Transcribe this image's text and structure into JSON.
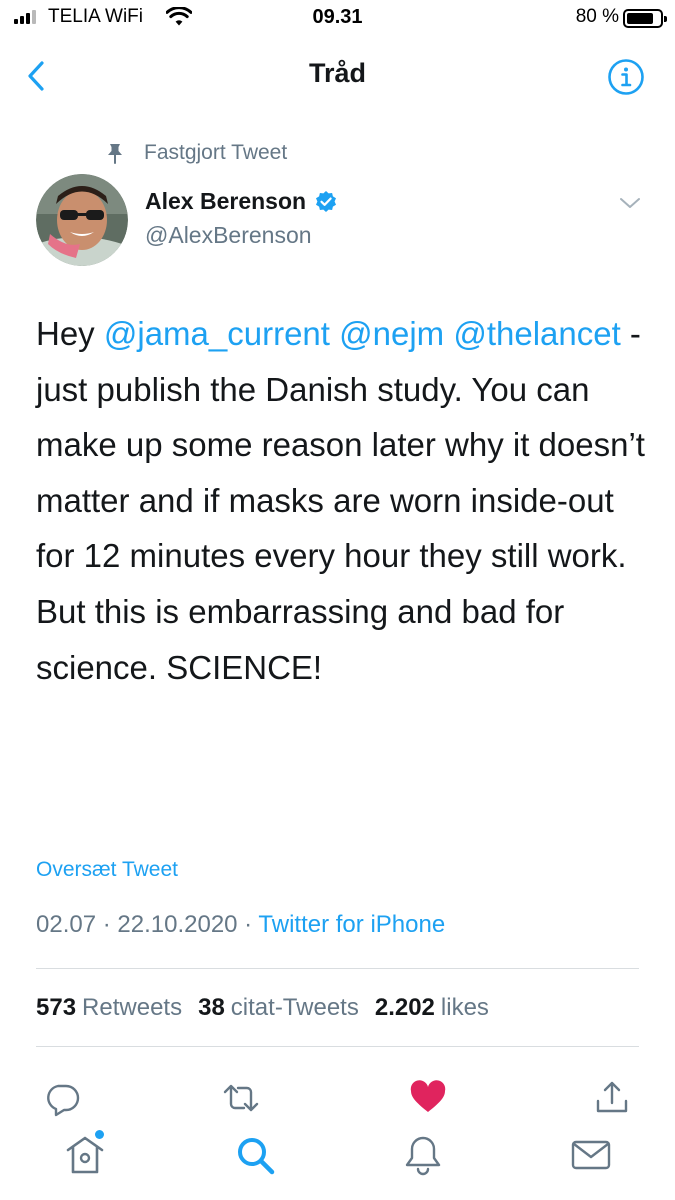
{
  "status_bar": {
    "carrier": "TELIA WiFi",
    "time": "09.31",
    "battery_percent": "80 %",
    "battery_level": 0.8
  },
  "nav": {
    "title": "Tråd"
  },
  "tweet": {
    "pinned_label": "Fastgjort Tweet",
    "author_name": "Alex Berenson",
    "author_handle": "@AlexBerenson",
    "mention_1": "@jama_current",
    "mention_2": "@nejm",
    "mention_3": "@thelancet",
    "text_intro": "Hey ",
    "text_after_mentions": " - just publish the Danish study. You can make up some reason later why it doesn’t matter and if masks are worn inside-out for 12 minutes every hour they still work. But this is embarrassing and bad for science. SCIENCE!",
    "translate_label": "Oversæt Tweet",
    "time": "02.07",
    "date": "22.10.2020",
    "separator": " · ",
    "source": "Twitter for iPhone"
  },
  "stats": {
    "retweets_count": "573",
    "retweets_label": "Retweets",
    "quotes_count": "38",
    "quotes_label": "citat-Tweets",
    "likes_count": "2.202",
    "likes_label": "likes"
  },
  "actions": [
    "reply-icon",
    "retweet-icon",
    "like-icon",
    "share-icon"
  ],
  "tab_bar": [
    "home-icon",
    "search-icon",
    "notifications-icon",
    "messages-icon"
  ],
  "colors": {
    "accent": "#1da1f2",
    "like": "#e0245e",
    "muted": "#657786",
    "text": "#14171a"
  }
}
